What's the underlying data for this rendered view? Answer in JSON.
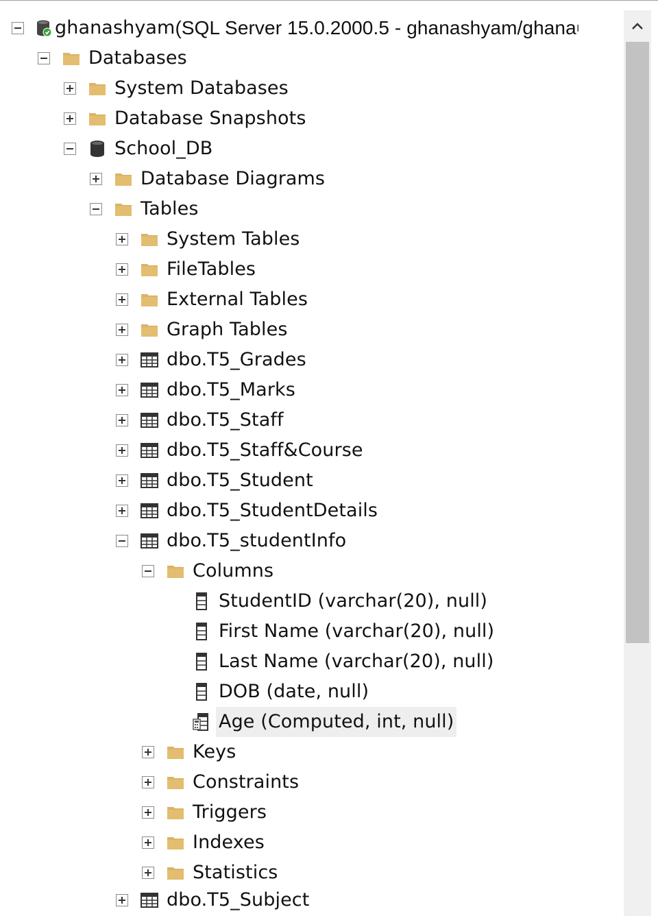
{
  "server": {
    "name": "ghanashyam",
    "info": "(SQL Server 15.0.2000.5 -  ghanashyam/ghana ",
    "truncation_mark": "ı"
  },
  "tree": {
    "databases": "Databases",
    "system_databases": "System Databases",
    "database_snapshots": "Database Snapshots",
    "school_db": "School_DB",
    "database_diagrams": "Database Diagrams",
    "tables": "Tables",
    "system_tables": "System Tables",
    "file_tables": "FileTables",
    "external_tables": "External Tables",
    "graph_tables": "Graph Tables",
    "t_grades": "dbo.T5_Grades",
    "t_marks": "dbo.T5_Marks",
    "t_staff": "dbo.T5_Staff",
    "t_staff_course": "dbo.T5_Staff&Course",
    "t_student": "dbo.T5_Student",
    "t_student_details": "dbo.T5_StudentDetails",
    "t_student_info": "dbo.T5_studentInfo",
    "columns": "Columns",
    "col_student_id": "StudentID (varchar(20), null)",
    "col_first_name": "First Name (varchar(20), null)",
    "col_last_name": "Last Name (varchar(20), null)",
    "col_dob": "DOB (date, null)",
    "col_age": "Age (Computed, int, null)",
    "keys": "Keys",
    "constraints": "Constraints",
    "triggers": "Triggers",
    "indexes": "Indexes",
    "statistics": "Statistics",
    "t_subject": "dbo.T5_Subject"
  },
  "colors": {
    "folder": "#dcb466",
    "selection": "#eeeeee",
    "scroll_track": "#f0f0f0",
    "scroll_thumb": "#c2c2c2",
    "connected_badge": "#3aa33a"
  },
  "scroll": {
    "thumb_fraction": 0.69
  }
}
